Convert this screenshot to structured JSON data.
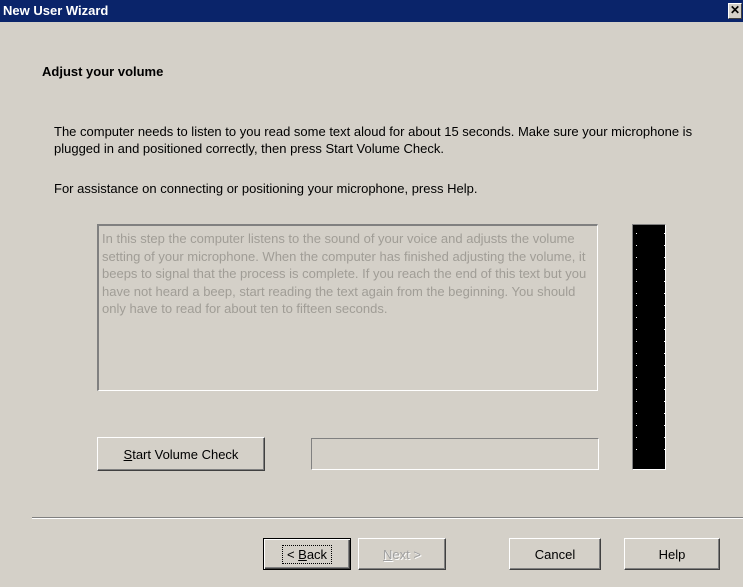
{
  "window": {
    "title": "New User Wizard",
    "close_glyph": "✕"
  },
  "page": {
    "heading": "Adjust your volume",
    "instructions": "The computer needs to listen to you read some text aloud for about 15 seconds.  Make sure your microphone is plugged in and positioned correctly, then press Start Volume Check.",
    "help_hint": "For assistance on connecting or positioning your microphone, press Help.",
    "read_text": "In this step the computer listens to the sound of your voice and adjusts the volume setting of your microphone. When the computer has finished adjusting the volume, it beeps to signal that the process is complete. If you reach the end of this text but you have not heard a beep, start reading the text again from the beginning. You should only have to read for about ten to fifteen seconds.",
    "status_value": "",
    "volume_level": 0
  },
  "buttons": {
    "start_volume_check": {
      "mnemonic": "S",
      "rest": "tart Volume Check"
    },
    "back": {
      "prefix": "< ",
      "mnemonic": "B",
      "rest": "ack"
    },
    "next": {
      "mnemonic": "N",
      "rest": "ext >"
    },
    "cancel": "Cancel",
    "help": "Help"
  },
  "colors": {
    "title_bar": "#0a246a",
    "dialog_face": "#d4d0c8",
    "meter_background": "#000000",
    "disabled_text": "#a09d96"
  }
}
